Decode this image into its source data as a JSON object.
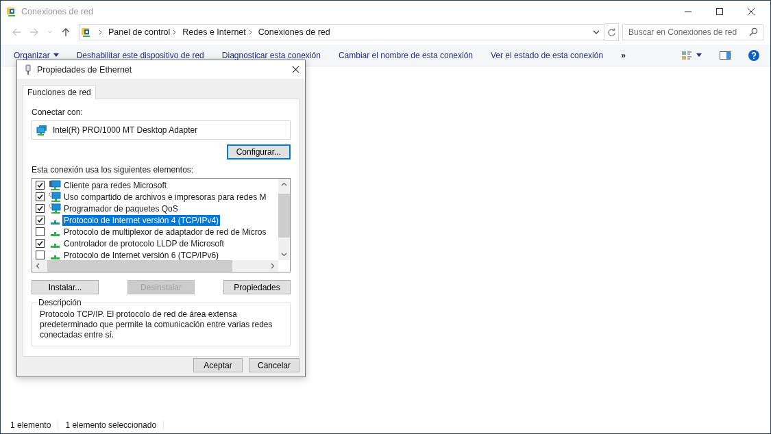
{
  "window": {
    "title": "Conexiones de red"
  },
  "address_bar": {
    "breadcrumbs": [
      "Panel de control",
      "Redes e Internet",
      "Conexiones de red"
    ]
  },
  "search": {
    "placeholder": "Buscar en Conexiones de red"
  },
  "toolbar": {
    "items": [
      "Organizar",
      "Deshabilitar este dispositivo de red",
      "Diagnosticar esta conexión",
      "Cambiar el nombre de esta conexión",
      "Ver el estado de esta conexión"
    ],
    "more": "»"
  },
  "dialog": {
    "title": "Propiedades de Ethernet",
    "tabs": [
      {
        "label": "Funciones de red",
        "selected": true
      }
    ],
    "connect_label": "Conectar con:",
    "adapter": "Intel(R) PRO/1000 MT Desktop Adapter",
    "configure_button": "Configurar...",
    "items_label": "Esta conexión usa los siguientes elementos:",
    "items": [
      {
        "kind": "client",
        "label": "Cliente para redes Microsoft",
        "checked": true,
        "selected": false
      },
      {
        "kind": "service",
        "label": "Uso compartido de archivos e impresoras para redes M",
        "checked": true,
        "selected": false
      },
      {
        "kind": "service",
        "label": "Programador de paquetes QoS",
        "checked": true,
        "selected": false
      },
      {
        "kind": "protocol",
        "label": "Protocolo de Internet versión 4 (TCP/IPv4)",
        "checked": true,
        "selected": true
      },
      {
        "kind": "protocol",
        "label": "Protocolo de multiplexor de adaptador de red de Micros",
        "checked": false,
        "selected": false
      },
      {
        "kind": "protocol",
        "label": "Controlador de protocolo LLDP de Microsoft",
        "checked": true,
        "selected": false
      },
      {
        "kind": "protocol",
        "label": "Protocolo de Internet versión 6 (TCP/IPv6)",
        "checked": false,
        "selected": false
      }
    ],
    "item_buttons": [
      {
        "label": "Instalar...",
        "disabled": false
      },
      {
        "label": "Desinstalar",
        "disabled": true
      },
      {
        "label": "Propiedades",
        "disabled": false
      }
    ],
    "description": {
      "legend": "Descripción",
      "text": "Protocolo TCP/IP. El protocolo de red de área extensa predeterminado que permite la comunicación entre varias redes conectadas entre sí."
    },
    "buttons": [
      "Aceptar",
      "Cancelar"
    ]
  },
  "status_bar": [
    "1 elemento",
    "1 elemento seleccionado"
  ]
}
